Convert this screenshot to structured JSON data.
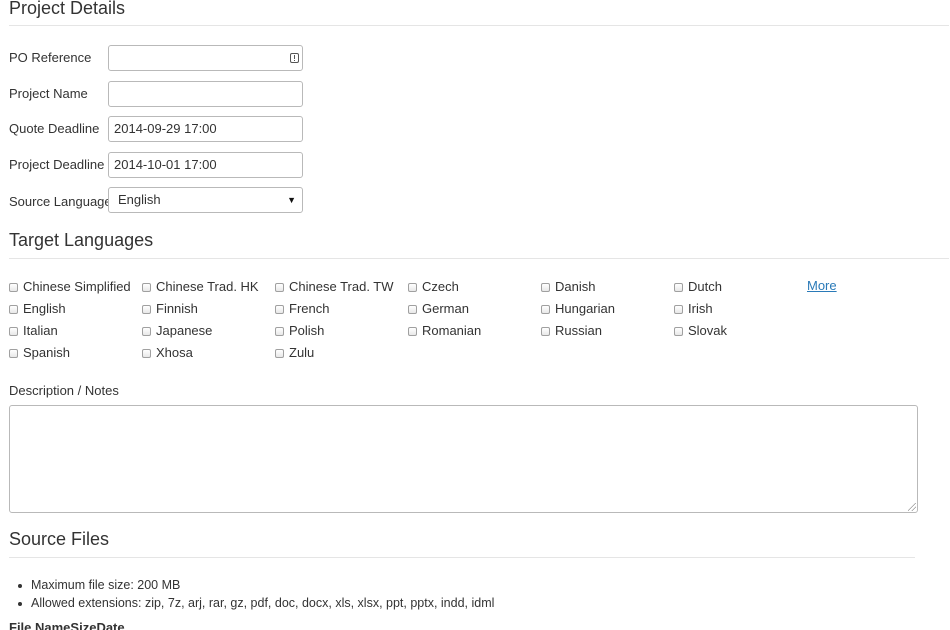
{
  "project_details": {
    "heading": "Project Details",
    "fields": {
      "po_reference": {
        "label": "PO Reference",
        "value": ""
      },
      "project_name": {
        "label": "Project Name",
        "value": ""
      },
      "quote_deadline": {
        "label": "Quote Deadline",
        "value": "2014-09-29 17:00"
      },
      "project_deadline": {
        "label": "Project Deadline",
        "value": "2014-10-01 17:00"
      },
      "source_language": {
        "label": "Source Language",
        "selected": "English"
      }
    }
  },
  "target_languages": {
    "heading": "Target Languages",
    "more_label": "More",
    "languages": [
      {
        "label": "Chinese Simplified",
        "checked": false
      },
      {
        "label": "Chinese Trad. HK",
        "checked": false
      },
      {
        "label": "Chinese Trad. TW",
        "checked": false
      },
      {
        "label": "Czech",
        "checked": false
      },
      {
        "label": "Danish",
        "checked": false
      },
      {
        "label": "Dutch",
        "checked": false
      },
      {
        "label": "English",
        "checked": false
      },
      {
        "label": "Finnish",
        "checked": false
      },
      {
        "label": "French",
        "checked": false
      },
      {
        "label": "German",
        "checked": false
      },
      {
        "label": "Hungarian",
        "checked": false
      },
      {
        "label": "Irish",
        "checked": false
      },
      {
        "label": "Italian",
        "checked": false
      },
      {
        "label": "Japanese",
        "checked": false
      },
      {
        "label": "Polish",
        "checked": false
      },
      {
        "label": "Romanian",
        "checked": false
      },
      {
        "label": "Russian",
        "checked": false
      },
      {
        "label": "Slovak",
        "checked": false
      },
      {
        "label": "Spanish",
        "checked": false
      },
      {
        "label": "Xhosa",
        "checked": false
      },
      {
        "label": "Zulu",
        "checked": false
      }
    ]
  },
  "notes": {
    "label": "Description / Notes",
    "value": ""
  },
  "source_files": {
    "heading": "Source Files",
    "info": [
      "Maximum file size: 200 MB",
      "Allowed extensions: zip, 7z, arj, rar, gz, pdf, doc, docx, xls, xlsx, ppt, pptx, indd, idml"
    ],
    "table_headers": [
      "File Name",
      "Size",
      "Date"
    ]
  },
  "colors": {
    "link": "#2a7ab8",
    "text": "#333333",
    "border": "#b9b9b9"
  }
}
